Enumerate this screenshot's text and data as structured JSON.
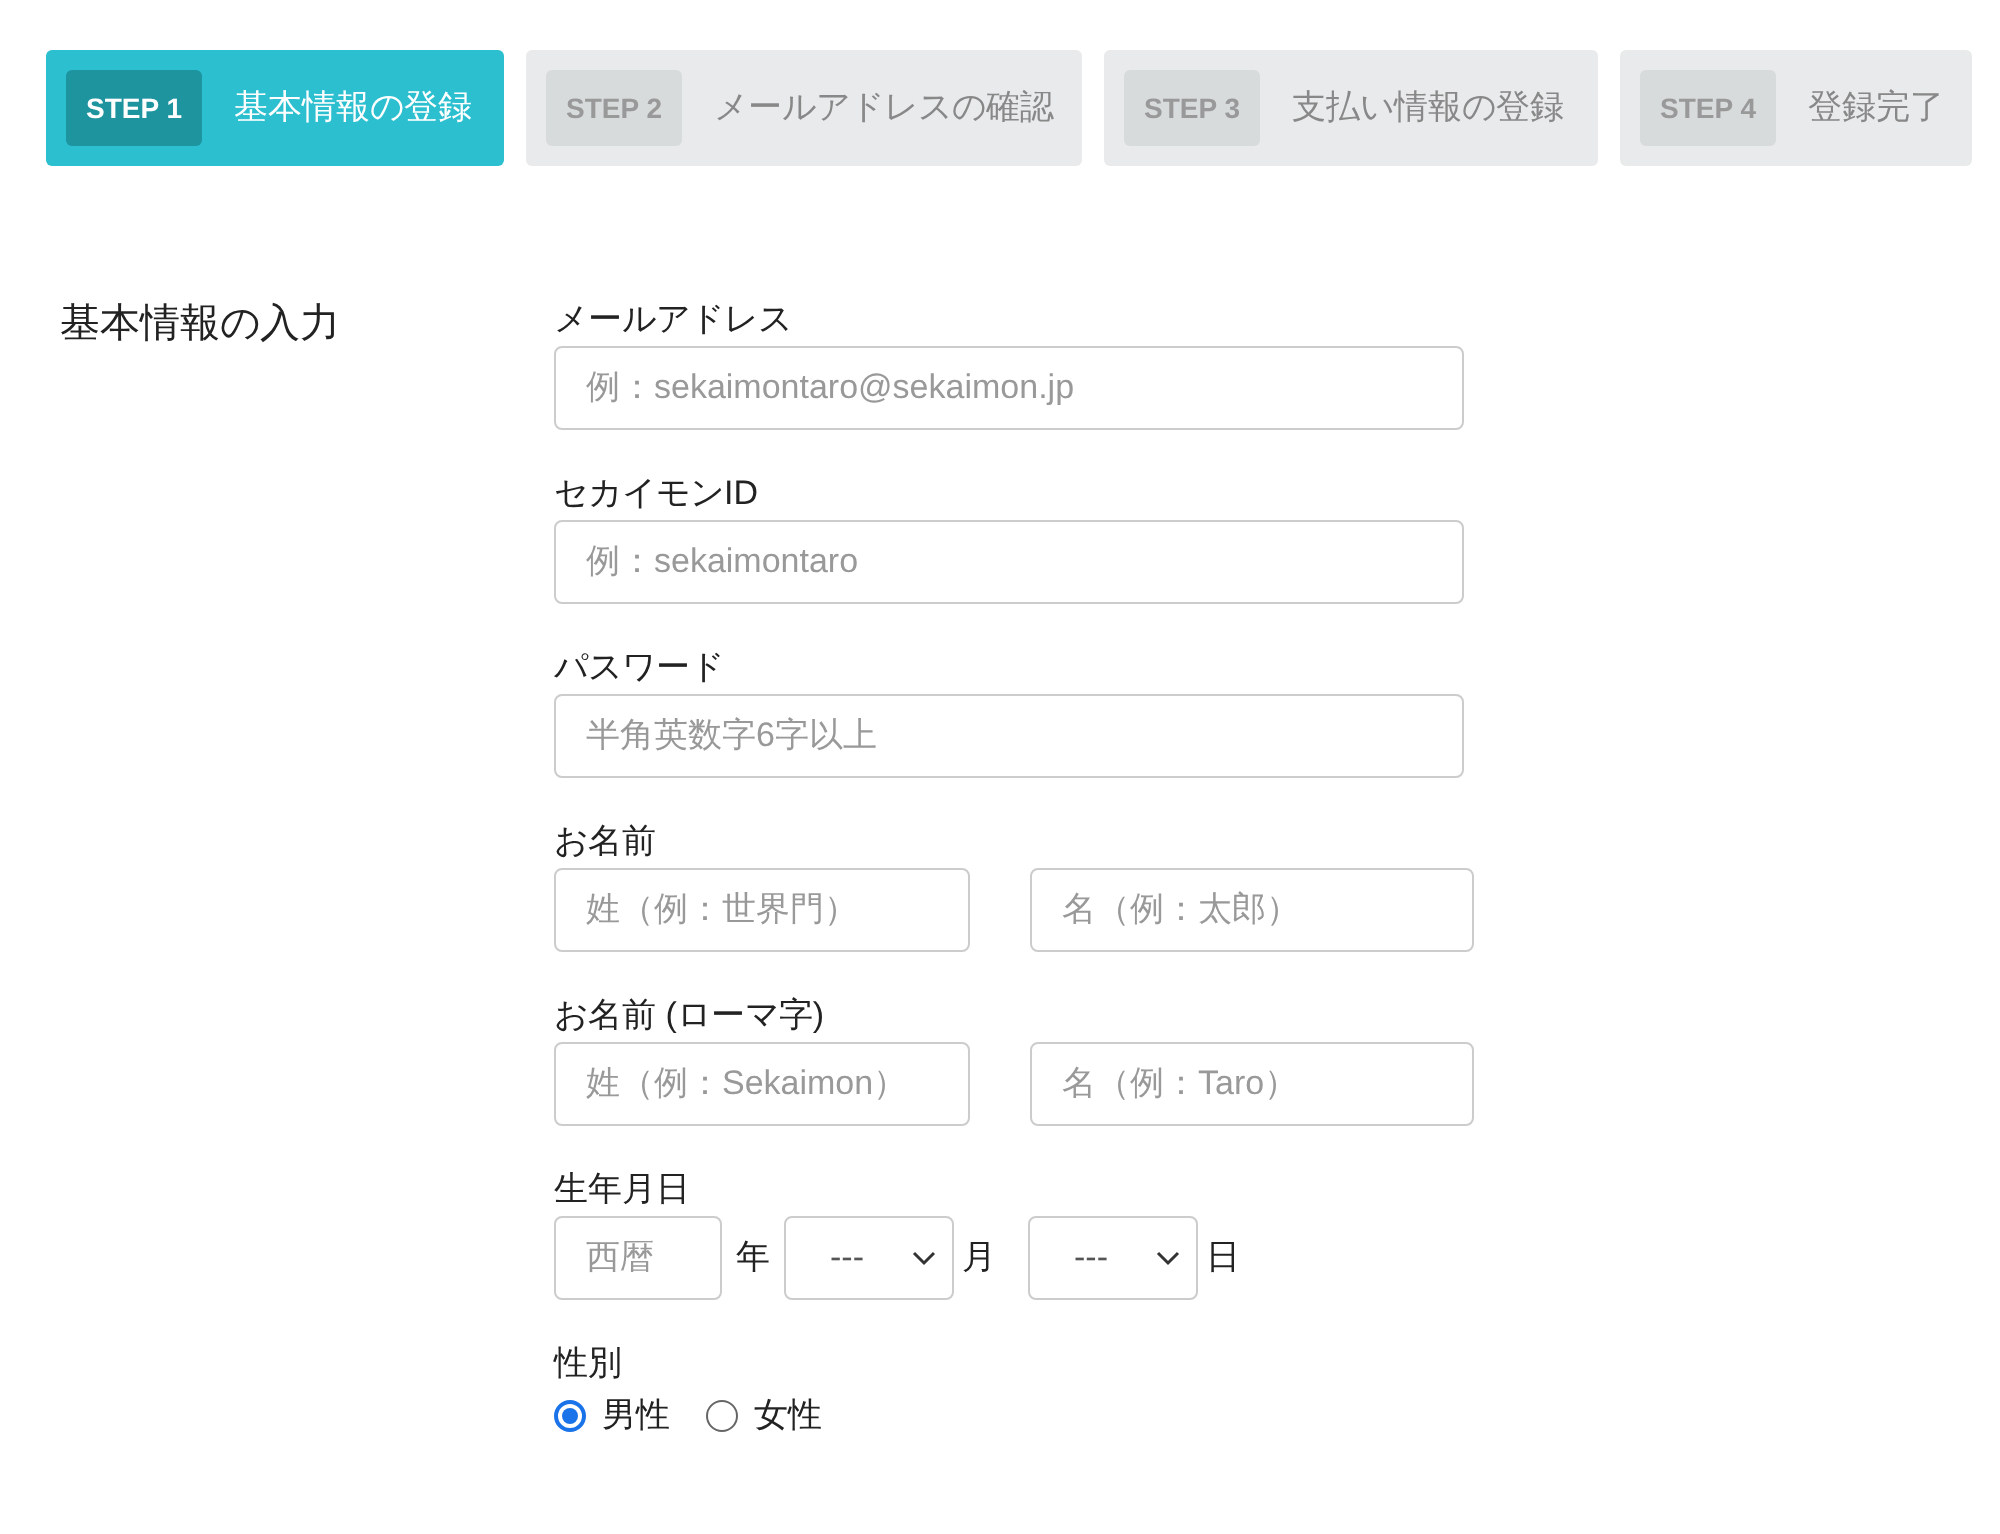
{
  "steps": [
    {
      "badge": "STEP 1",
      "label": "基本情報の登録",
      "selected": true
    },
    {
      "badge": "STEP 2",
      "label": "メールアドレスの確認",
      "selected": false
    },
    {
      "badge": "STEP 3",
      "label": "支払い情報の登録",
      "selected": false
    },
    {
      "badge": "STEP 4",
      "label": "登録完了",
      "selected": false
    }
  ],
  "section_title": "基本情報の入力",
  "fields": [
    {
      "label": "メールアドレス",
      "inputs": [
        {
          "placeholder": "例：sekaimontaro@sekaimon.jp"
        }
      ]
    },
    {
      "label": "セカイモンID",
      "inputs": [
        {
          "placeholder": "例：sekaimontaro"
        }
      ]
    },
    {
      "label": "パスワード",
      "inputs": [
        {
          "placeholder": "半角英数字6字以上"
        }
      ]
    },
    {
      "label": "お名前",
      "inputs": [
        {
          "placeholder": "姓（例：世界門）"
        },
        {
          "placeholder": "名（例：太郎）"
        }
      ]
    },
    {
      "label": "お名前 (ローマ字)",
      "inputs": [
        {
          "placeholder": "姓（例：Sekaimon）"
        },
        {
          "placeholder": "名（例：Taro）"
        }
      ]
    }
  ],
  "birthday": {
    "label": "生年月日",
    "year": {
      "placeholder": "西暦",
      "unit": "年"
    },
    "month": {
      "value": "---",
      "unit": "月"
    },
    "day": {
      "value": "---",
      "unit": "日"
    }
  },
  "gender": {
    "label": "性別",
    "options": [
      {
        "label": "男性",
        "selected": true
      },
      {
        "label": "女性",
        "selected": false
      }
    ]
  }
}
